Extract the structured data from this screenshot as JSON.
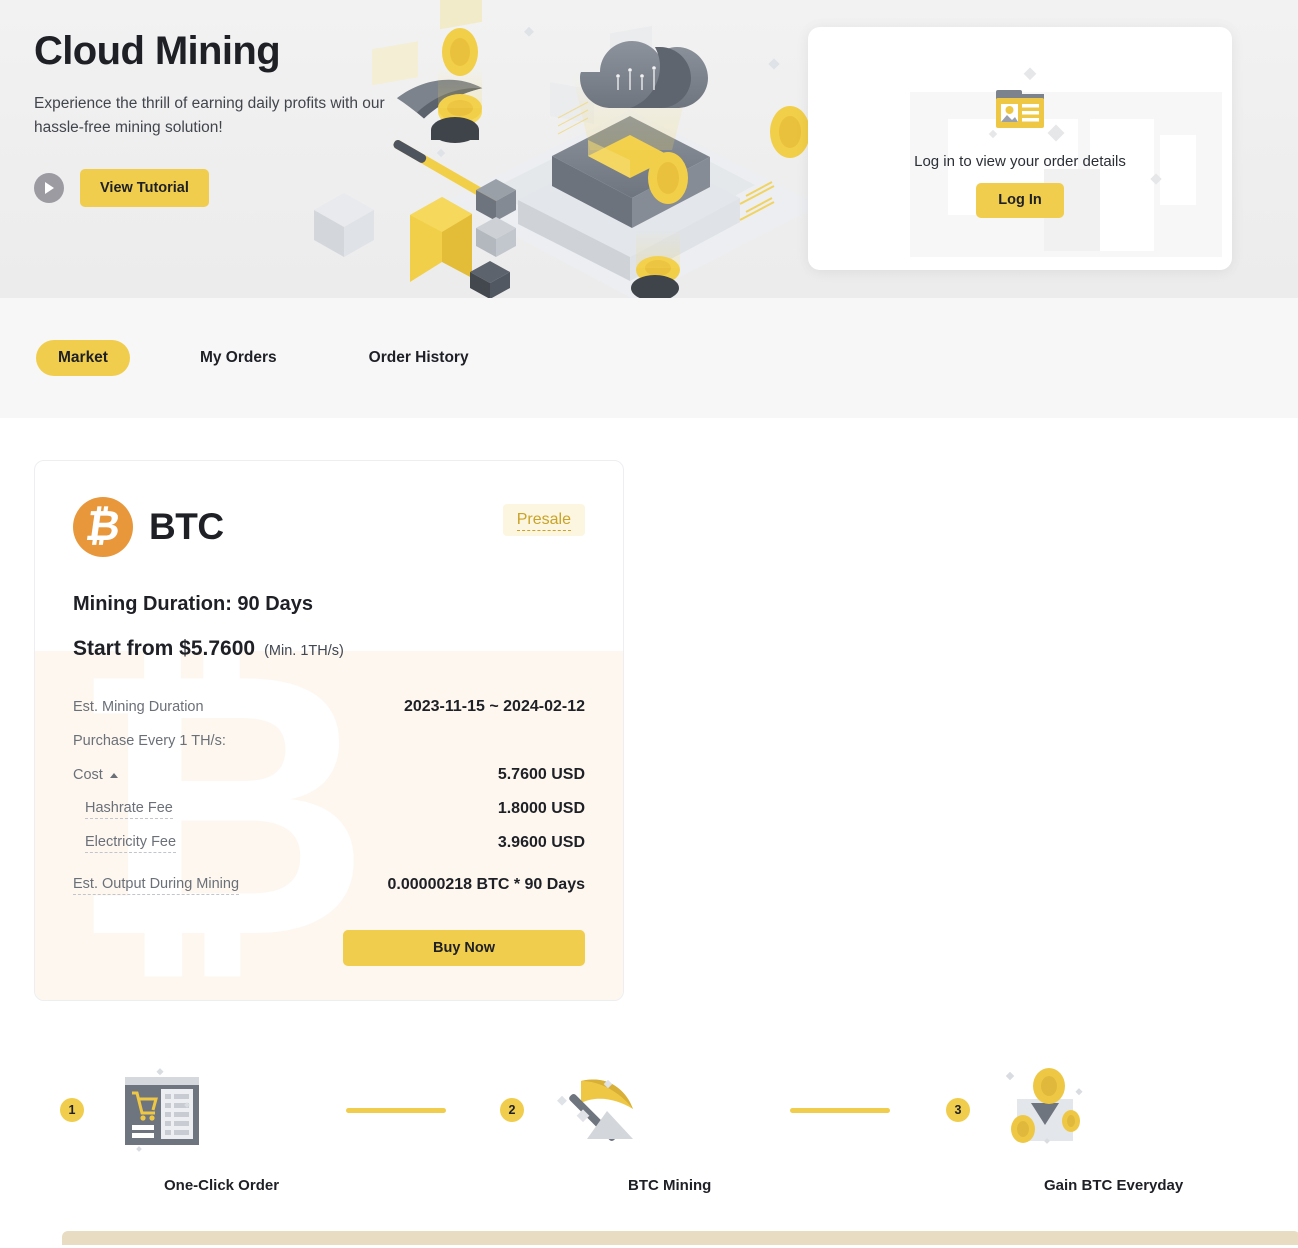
{
  "hero": {
    "title": "Cloud Mining",
    "subtitle": "Experience the thrill of earning daily profits with our hassle-free mining solution!",
    "tutorial_button": "View Tutorial",
    "play_icon": "play-icon",
    "illustration": "cloud-mining-isometric-illustration"
  },
  "login_card": {
    "icon": "id-card-folder-icon",
    "message": "Log in to view your order details",
    "button": "Log In"
  },
  "tabs": [
    {
      "label": "Market",
      "active": true
    },
    {
      "label": "My Orders",
      "active": false
    },
    {
      "label": "Order History",
      "active": false
    }
  ],
  "product": {
    "coin": "BTC",
    "coin_icon": "bitcoin-icon",
    "badge": "Presale",
    "duration_line": "Mining Duration: 90 Days",
    "start_from_label": "Start from $5.7600",
    "min_hashrate": "(Min. 1TH/s)",
    "rows": [
      {
        "label": "Est. Mining Duration",
        "value": "2023-11-15 ~ 2024-02-12",
        "dotted": false,
        "sub": false,
        "caret": false
      },
      {
        "label": "Purchase Every 1 TH/s:",
        "value": "",
        "dotted": false,
        "sub": false,
        "caret": false
      },
      {
        "label": "Cost",
        "value": "5.7600 USD",
        "dotted": false,
        "sub": false,
        "caret": true
      },
      {
        "label": "Hashrate Fee",
        "value": "1.8000 USD",
        "dotted": true,
        "sub": true,
        "caret": false
      },
      {
        "label": "Electricity Fee",
        "value": "3.9600 USD",
        "dotted": true,
        "sub": true,
        "caret": false
      },
      {
        "label": "Est. Output During Mining",
        "value": "0.00000218 BTC * 90 Days",
        "dotted": true,
        "sub": false,
        "caret": false
      }
    ],
    "buy_button": "Buy Now"
  },
  "steps": [
    {
      "num": "1",
      "label": "One-Click Order",
      "icon": "order-list-cart-icon"
    },
    {
      "num": "2",
      "label": "BTC Mining",
      "icon": "pickaxe-mining-icon"
    },
    {
      "num": "3",
      "label": "Gain BTC Everyday",
      "icon": "coins-envelope-icon"
    }
  ],
  "colors": {
    "accent": "#f0cd4c",
    "btc_orange": "#e8973b",
    "badge_bg": "#fcf6e0",
    "badge_text": "#c9a227",
    "card_wash": "#fdf7f0",
    "bottom_bar": "#e8ddc2",
    "text": "#1e2026",
    "muted": "#6b7078"
  }
}
